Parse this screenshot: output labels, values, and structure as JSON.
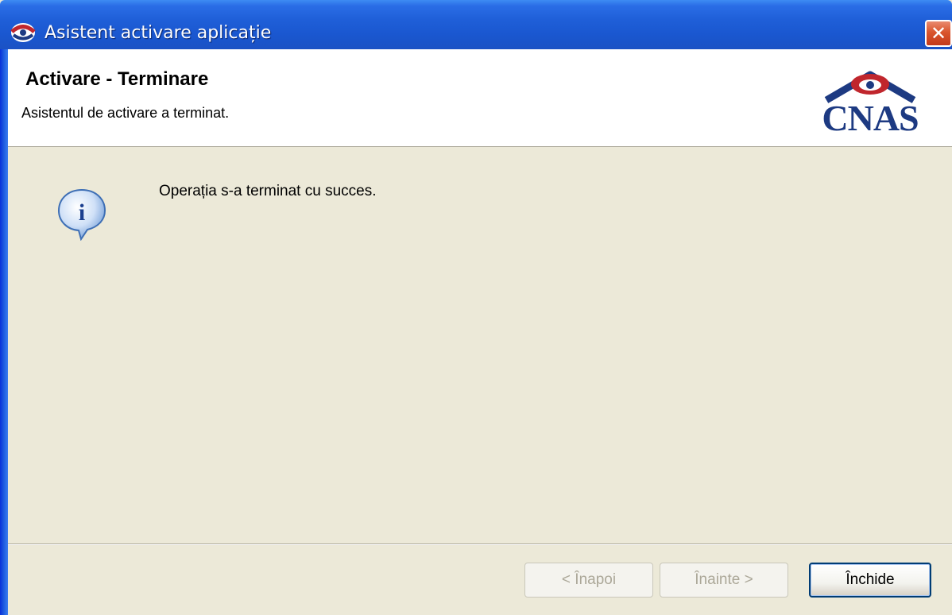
{
  "window": {
    "title": "Asistent activare aplicație",
    "title_icon": "cnas-app-icon",
    "close_label": "✕"
  },
  "header": {
    "title": "Activare - Terminare",
    "subtitle": "Asistentul de activare a terminat.",
    "logo_text": "CNAS"
  },
  "content": {
    "icon": "info-icon",
    "message": "Operația s-a terminat cu succes."
  },
  "buttons": {
    "back": "< Înapoi",
    "next": "Înainte >",
    "close": "Închide"
  },
  "colors": {
    "titlebar": "#1f5fd8",
    "dialog_background": "#ece9d8",
    "logo_blue": "#1d3a82",
    "logo_red": "#c0262d"
  }
}
